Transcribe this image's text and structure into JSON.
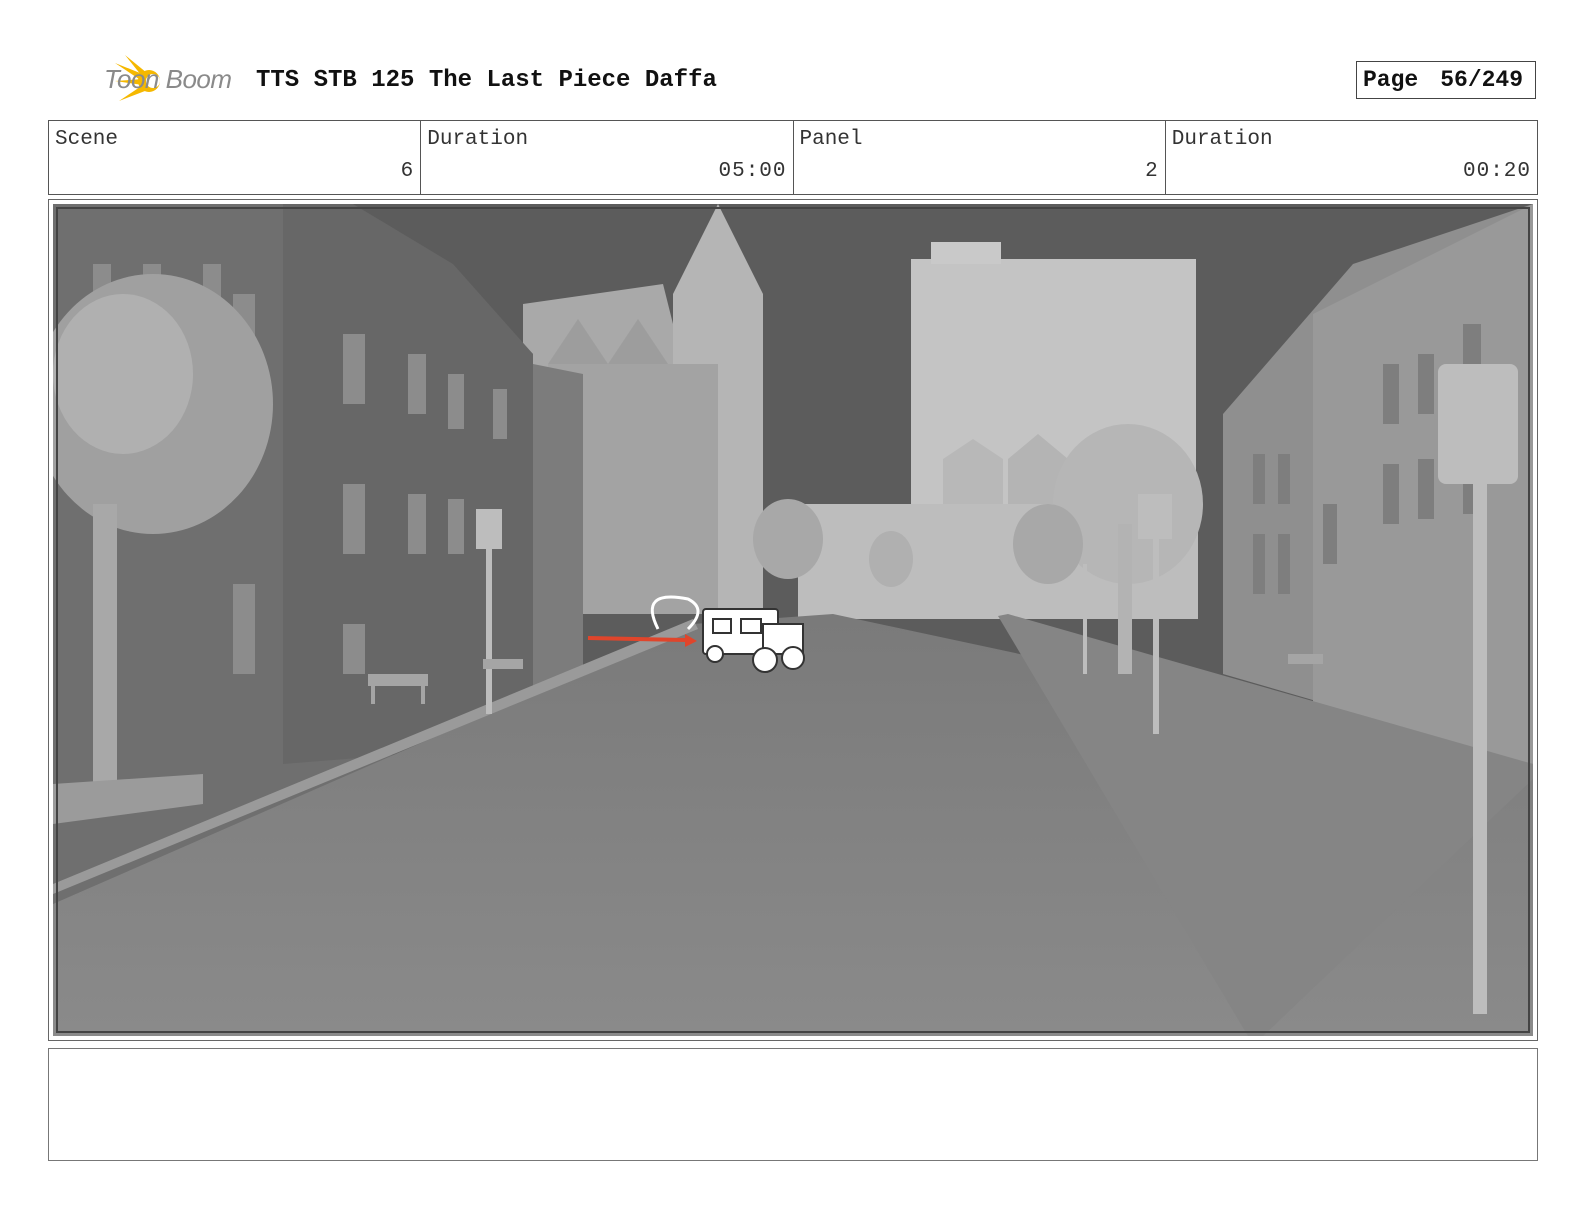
{
  "header": {
    "logo_text": "Toon Boom",
    "title": "TTS STB 125 The Last Piece Daffa",
    "page_label": "Page",
    "page_number": "56/249"
  },
  "info": {
    "scene_label": "Scene",
    "scene_value": "6",
    "scene_duration_label": "Duration",
    "scene_duration_value": "05:00",
    "panel_label": "Panel",
    "panel_value": "2",
    "panel_duration_label": "Duration",
    "panel_duration_value": "00:20"
  },
  "colors": {
    "logo_accent": "#f5b800",
    "motion_arrow": "#e0452b"
  },
  "notes": {
    "text": ""
  }
}
